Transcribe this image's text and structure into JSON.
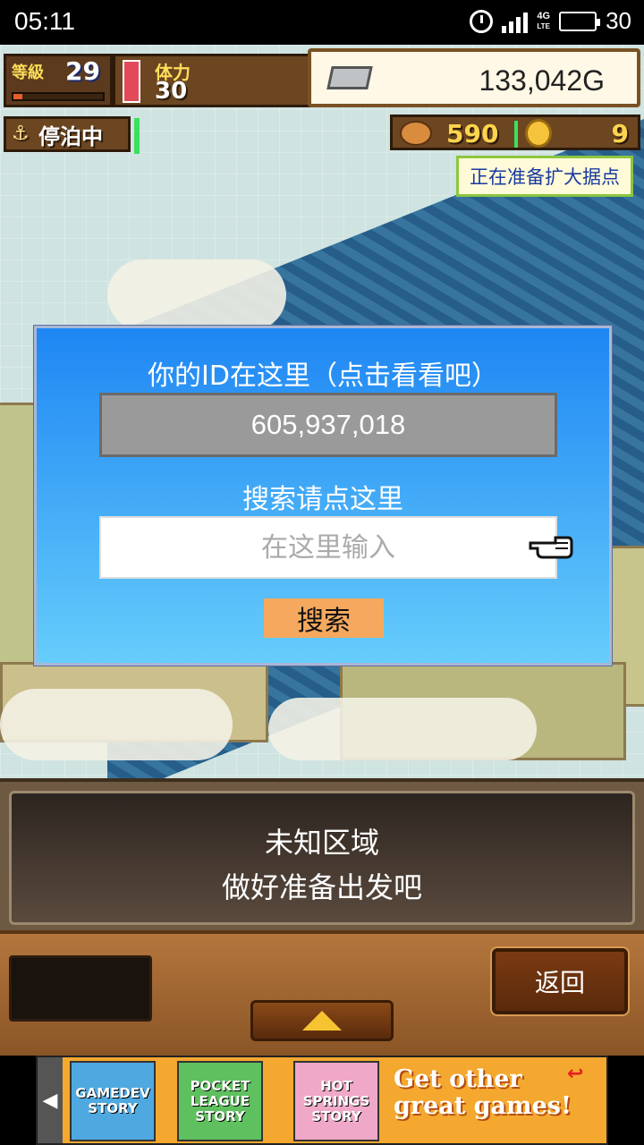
{
  "status_bar": {
    "time": "05:11",
    "network": "4G",
    "network_sub": "LTE",
    "battery": "30",
    "icons": [
      "alarm-icon",
      "signal-icon",
      "battery-icon"
    ]
  },
  "hud": {
    "level_label": "等級",
    "level_value": "29",
    "stamina_label": "体力",
    "stamina_value": "30",
    "gold": "133,042G",
    "anchor_status": "停泊中",
    "food": "590",
    "coins": "9",
    "notice": "正在准备扩大据点"
  },
  "dialog": {
    "title": "你的ID在这里（点击看看吧）",
    "user_id": "605,937,018",
    "search_title": "搜索请点这里",
    "search_placeholder": "在这里输入",
    "search_value": "",
    "search_button": "搜索"
  },
  "message": {
    "line1": "未知区域",
    "line2": "做好准备出发吧"
  },
  "bottom_bar": {
    "back_button": "返回"
  },
  "ad": {
    "games": [
      {
        "line1": "GAMEDEV",
        "line2": "STORY"
      },
      {
        "line1": "POCKET",
        "line2": "LEAGUE",
        "line3": "STORY"
      },
      {
        "line1": "HOT",
        "line2": "SPRINGS",
        "line3": "STORY"
      }
    ],
    "cta": "Get other great games!"
  },
  "colors": {
    "dialog_top": "#1e86f3",
    "dialog_bottom": "#66cdfb",
    "button": "#f6a95e",
    "notice_text": "#1a3aa0"
  }
}
